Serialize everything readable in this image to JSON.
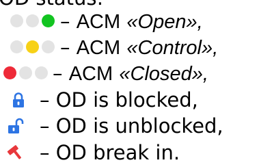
{
  "header": {
    "text": "OD status:"
  },
  "rows": [
    {
      "lights": [
        {
          "color": "#e3e3e3"
        },
        {
          "color": "#e3e3e3"
        },
        {
          "color": "#12c421"
        }
      ],
      "dash": "–",
      "acm": "ACM",
      "state": "«Open»,"
    },
    {
      "lights": [
        {
          "color": "#e3e3e3"
        },
        {
          "color": "#f7d117"
        },
        {
          "color": "#e3e3e3"
        }
      ],
      "dash": "–",
      "acm": "ACM",
      "state": "«Control»,"
    },
    {
      "lights": [
        {
          "color": "#ee2a38"
        },
        {
          "color": "#e3e3e3"
        },
        {
          "color": "#e3e3e3"
        }
      ],
      "dash": "–",
      "acm": "ACM",
      "state": "«Closed»,"
    },
    {
      "icon": "lock-closed-icon",
      "icon_color": "#2d74e3",
      "dash": "–",
      "text": "OD is blocked,"
    },
    {
      "icon": "lock-open-icon",
      "icon_color": "#2d74e3",
      "dash": "–",
      "text": "OD is unblocked,"
    },
    {
      "icon": "hammer-icon",
      "icon_color": "#e8383c",
      "dash": "–",
      "text": "OD break in."
    }
  ]
}
